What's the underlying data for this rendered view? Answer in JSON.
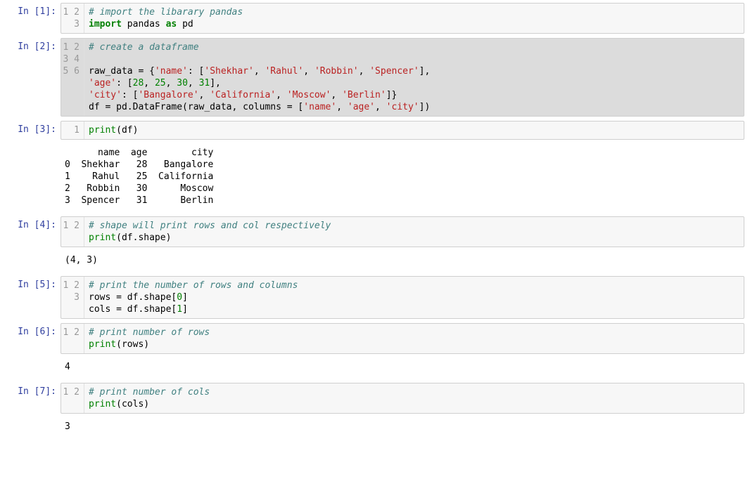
{
  "cells": [
    {
      "prompt": "In [1]:",
      "selected": false,
      "lines": [
        [
          {
            "t": "# import the libarary pandas",
            "c": "tok-comment"
          }
        ],
        [
          {
            "t": "import",
            "c": "tok-keyword"
          },
          {
            "t": " pandas ",
            "c": ""
          },
          {
            "t": "as",
            "c": "tok-keyword"
          },
          {
            "t": " pd",
            "c": ""
          }
        ],
        [
          {
            "t": "",
            "c": ""
          }
        ]
      ],
      "output": null
    },
    {
      "prompt": "In [2]:",
      "selected": true,
      "lines": [
        [
          {
            "t": "# create a dataframe",
            "c": "tok-comment"
          }
        ],
        [
          {
            "t": "",
            "c": ""
          }
        ],
        [
          {
            "t": "raw_data = {",
            "c": ""
          },
          {
            "t": "'name'",
            "c": "tok-string"
          },
          {
            "t": ": [",
            "c": ""
          },
          {
            "t": "'Shekhar'",
            "c": "tok-string"
          },
          {
            "t": ", ",
            "c": ""
          },
          {
            "t": "'Rahul'",
            "c": "tok-string"
          },
          {
            "t": ", ",
            "c": ""
          },
          {
            "t": "'Robbin'",
            "c": "tok-string"
          },
          {
            "t": ", ",
            "c": ""
          },
          {
            "t": "'Spencer'",
            "c": "tok-string"
          },
          {
            "t": "],",
            "c": ""
          }
        ],
        [
          {
            "t": "'age'",
            "c": "tok-string"
          },
          {
            "t": ": [",
            "c": ""
          },
          {
            "t": "28",
            "c": "tok-number"
          },
          {
            "t": ", ",
            "c": ""
          },
          {
            "t": "25",
            "c": "tok-number"
          },
          {
            "t": ", ",
            "c": ""
          },
          {
            "t": "30",
            "c": "tok-number"
          },
          {
            "t": ", ",
            "c": ""
          },
          {
            "t": "31",
            "c": "tok-number"
          },
          {
            "t": "],",
            "c": ""
          }
        ],
        [
          {
            "t": "'city'",
            "c": "tok-string"
          },
          {
            "t": ": [",
            "c": ""
          },
          {
            "t": "'Bangalore'",
            "c": "tok-string"
          },
          {
            "t": ", ",
            "c": ""
          },
          {
            "t": "'California'",
            "c": "tok-string"
          },
          {
            "t": ", ",
            "c": ""
          },
          {
            "t": "'Moscow'",
            "c": "tok-string"
          },
          {
            "t": ", ",
            "c": ""
          },
          {
            "t": "'Berlin'",
            "c": "tok-string"
          },
          {
            "t": "]}",
            "c": ""
          }
        ],
        [
          {
            "t": "df = pd.DataFrame(raw_data, columns = [",
            "c": ""
          },
          {
            "t": "'name'",
            "c": "tok-string"
          },
          {
            "t": ", ",
            "c": ""
          },
          {
            "t": "'age'",
            "c": "tok-string"
          },
          {
            "t": ", ",
            "c": ""
          },
          {
            "t": "'city'",
            "c": "tok-string"
          },
          {
            "t": "])",
            "c": ""
          }
        ]
      ],
      "output": null
    },
    {
      "prompt": "In [3]:",
      "selected": false,
      "lines": [
        [
          {
            "t": "print",
            "c": "tok-builtin"
          },
          {
            "t": "(df)",
            "c": ""
          }
        ]
      ],
      "output": "      name  age        city\n0  Shekhar   28   Bangalore\n1    Rahul   25  California\n2   Robbin   30      Moscow\n3  Spencer   31      Berlin"
    },
    {
      "prompt": "In [4]:",
      "selected": false,
      "lines": [
        [
          {
            "t": "# shape will print rows and col respectively",
            "c": "tok-comment"
          }
        ],
        [
          {
            "t": "print",
            "c": "tok-builtin"
          },
          {
            "t": "(df.shape)",
            "c": ""
          }
        ]
      ],
      "output": "(4, 3)"
    },
    {
      "prompt": "In [5]:",
      "selected": false,
      "lines": [
        [
          {
            "t": "# print the number of rows and columns",
            "c": "tok-comment"
          }
        ],
        [
          {
            "t": "rows = df.shape[",
            "c": ""
          },
          {
            "t": "0",
            "c": "tok-number"
          },
          {
            "t": "]",
            "c": ""
          }
        ],
        [
          {
            "t": "cols = df.shape[",
            "c": ""
          },
          {
            "t": "1",
            "c": "tok-number"
          },
          {
            "t": "]",
            "c": ""
          }
        ]
      ],
      "output": null
    },
    {
      "prompt": "In [6]:",
      "selected": false,
      "lines": [
        [
          {
            "t": "# print number of rows",
            "c": "tok-comment"
          }
        ],
        [
          {
            "t": "print",
            "c": "tok-builtin"
          },
          {
            "t": "(rows)",
            "c": ""
          }
        ]
      ],
      "output": "4"
    },
    {
      "prompt": "In [7]:",
      "selected": false,
      "lines": [
        [
          {
            "t": "# print number of cols",
            "c": "tok-comment"
          }
        ],
        [
          {
            "t": "print",
            "c": "tok-builtin"
          },
          {
            "t": "(cols)",
            "c": ""
          }
        ]
      ],
      "output": "3"
    }
  ]
}
